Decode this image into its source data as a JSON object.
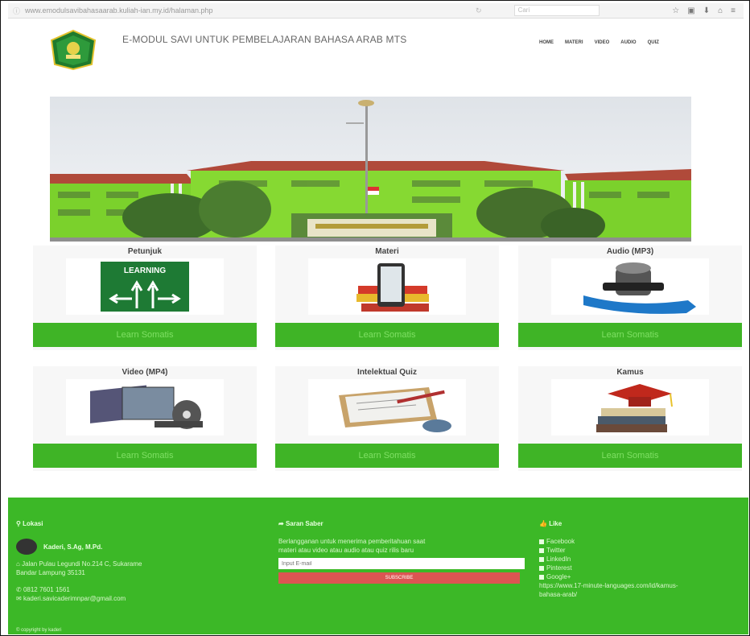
{
  "browser": {
    "url": "www.emodulsavibahasaarab.kuliah-ian.my.id/halaman.php",
    "search_placeholder": "Cari",
    "icons": [
      "reload-icon",
      "star-icon",
      "home-icon",
      "download-icon",
      "menu-icon"
    ]
  },
  "header": {
    "title": "E-MODUL SAVI UNTUK PEMBELAJARAN BAHASA ARAB MTS",
    "nav": [
      "HOME",
      "MATERI",
      "VIDEO",
      "AUDIO",
      "QUIZ"
    ]
  },
  "cards": [
    {
      "title": "Petunjuk",
      "button": "Learn Somatis",
      "icon": "learning-sign-icon"
    },
    {
      "title": "Materi",
      "button": "Learn Somatis",
      "icon": "books-tablet-icon"
    },
    {
      "title": "Audio (MP3)",
      "button": "Learn Somatis",
      "icon": "audio-mp3-icon"
    },
    {
      "title": "Video (MP4)",
      "button": "Learn Somatis",
      "icon": "video-film-icon"
    },
    {
      "title": "Intelektual Quiz",
      "button": "Learn Somatis",
      "icon": "quiz-clipboard-icon"
    },
    {
      "title": "Kamus",
      "button": "Learn Somatis",
      "icon": "graduation-books-icon"
    }
  ],
  "footer": {
    "lokasi": {
      "heading": "Lokasi",
      "name": "Kaderi, S.Ag, M.Pd.",
      "address_1": "Jalan Pulau Legundi No.214 C, Sukarame",
      "address_2": "Bandar Lampung 35131",
      "phone": "0812 7601 1561",
      "email": "kaderi.savicaderimnpar@gmail.com"
    },
    "saran": {
      "heading": "Saran Saber",
      "text_1": "Berlangganan untuk menerima pemberitahuan saat",
      "text_2": "materi atau video atau audio atau quiz rilis baru",
      "email_placeholder": "Input E-mail",
      "button": "SUBSCRIBE"
    },
    "like": {
      "heading": "Like",
      "items": [
        "Facebook",
        "Twitter",
        "LinkedIn",
        "Pinterest",
        "Google+"
      ],
      "link_1": "https://www.17-minute-languages.com/id/kamus-",
      "link_2": "bahasa-arab/"
    },
    "copyright": "© copyright by kaderi"
  }
}
